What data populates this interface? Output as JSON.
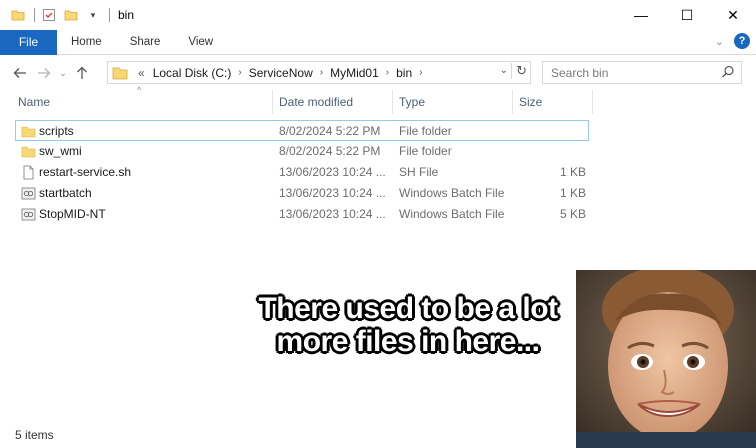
{
  "window": {
    "title": "bin",
    "controls": {
      "minimize": "—",
      "maximize": "☐",
      "close": "✕"
    }
  },
  "ribbon": {
    "file_label": "File",
    "tabs": [
      "Home",
      "Share",
      "View"
    ],
    "help_label": "?"
  },
  "address": {
    "overflow": "«",
    "crumbs": [
      "Local Disk (C:)",
      "ServiceNow",
      "MyMid01",
      "bin"
    ]
  },
  "search": {
    "placeholder": "Search bin"
  },
  "columns": {
    "name": "Name",
    "date": "Date modified",
    "type": "Type",
    "size": "Size"
  },
  "files": [
    {
      "name": "scripts",
      "date": "8/02/2024 5:22 PM",
      "type": "File folder",
      "size": "",
      "icon": "folder-icon"
    },
    {
      "name": "sw_wmi",
      "date": "8/02/2024 5:22 PM",
      "type": "File folder",
      "size": "",
      "icon": "folder-icon"
    },
    {
      "name": "restart-service.sh",
      "date": "13/06/2023 10:24 ...",
      "type": "SH File",
      "size": "1 KB",
      "icon": "file-icon"
    },
    {
      "name": "startbatch",
      "date": "13/06/2023 10:24 ...",
      "type": "Windows Batch File",
      "size": "1 KB",
      "icon": "batch-file-icon"
    },
    {
      "name": "StopMID-NT",
      "date": "13/06/2023 10:24 ...",
      "type": "Windows Batch File",
      "size": "5 KB",
      "icon": "batch-file-icon"
    }
  ],
  "status": {
    "item_count": "5 items"
  },
  "meme": {
    "line1": "There used to be a lot",
    "line2": "more files in here..."
  },
  "colors": {
    "accent": "#1a67c0",
    "folder": "#f8d775",
    "selection_border": "#99c9ef"
  }
}
